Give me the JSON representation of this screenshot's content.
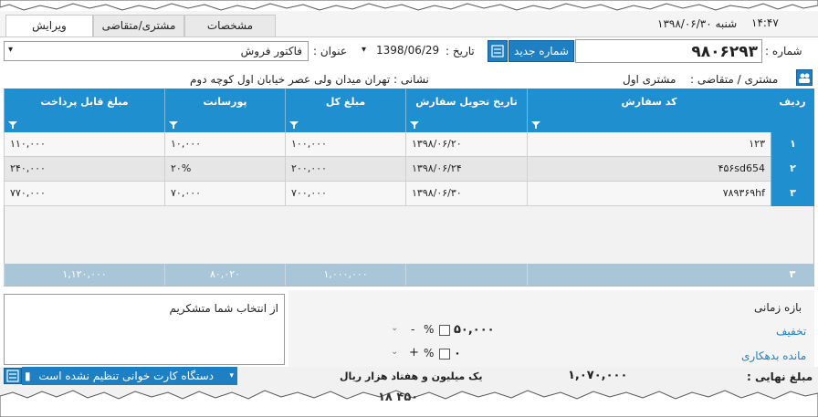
{
  "header": {
    "time": "۱۴:۴۷",
    "date_text": "شنبه ۱۳۹۸/۰۶/۳۰",
    "tabs": [
      {
        "label": "ویرایش",
        "active": true
      },
      {
        "label": "مشتری/متقاضی",
        "active": false
      },
      {
        "label": "مشخصات",
        "active": false
      }
    ]
  },
  "form": {
    "number_label": "شماره :",
    "number_value": "۹۸۰۶۲۹۳",
    "new_number_button": "شماره جدید",
    "date_label": "تاریخ :",
    "date_value": "1398/06/29",
    "title_label": "عنوان :",
    "title_value": "فاکتور فروش",
    "customer_label": "مشتری / متقاضی :",
    "customer_value": "مشتری اول",
    "address_text": "نشانی : تهران میدان ولی عصر خیابان اول کوچه دوم"
  },
  "grid": {
    "columns": [
      "ردیف",
      "کد سفارش",
      "تاریخ تحویل سفارش",
      "مبلغ کل",
      "پورسانت",
      "مبلغ قابل پرداخت"
    ],
    "rows": [
      {
        "index": "۱",
        "code": "۱۲۳",
        "date": "۱۳۹۸/۰۶/۲۰",
        "total": "۱۰۰,۰۰۰",
        "commission": "۱۰,۰۰۰",
        "payable": "۱۱۰,۰۰۰"
      },
      {
        "index": "۲",
        "code": "۴۵۶sd654",
        "date": "۱۳۹۸/۰۶/۲۴",
        "total": "۲۰۰,۰۰۰",
        "commission": "۲۰%",
        "payable": "۲۴۰,۰۰۰"
      },
      {
        "index": "۳",
        "code": "۷۸۹۳۶۹hf",
        "date": "۱۳۹۸/۰۶/۳۰",
        "total": "۷۰۰,۰۰۰",
        "commission": "۷۰,۰۰۰",
        "payable": "۷۷۰,۰۰۰"
      }
    ],
    "footer": {
      "count": "۳",
      "total": "۱,۰۰۰,۰۰۰",
      "commission": "۸۰,۰۲۰",
      "payable": "۱,۱۲۰,۰۰۰"
    }
  },
  "bottom": {
    "period_label": "بازه زمانی",
    "discount_link": "تخفیف",
    "debt_link": "مانده بدهکاری",
    "discount_value": "۵۰,۰۰۰",
    "discount_sign": "-",
    "debt_value": "۰",
    "debt_sign": "+",
    "percent_label": "%",
    "notes": "از انتخاب شما متشکریم",
    "final_label": "مبلغ نهایی :",
    "final_value": "۱,۰۷۰,۰۰۰",
    "final_words": "یک میلیون و هفتاد هزار ریال",
    "card_reader": "دستگاه کارت خوانی تنظیم نشده است",
    "cut_text": "۱۸ ۴۵۰"
  }
}
